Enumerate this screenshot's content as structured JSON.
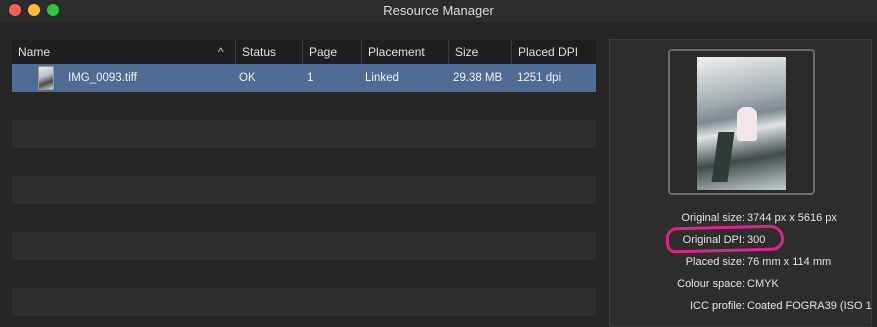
{
  "window": {
    "title": "Resource Manager"
  },
  "table": {
    "columns": [
      "Name",
      "Status",
      "Page",
      "Placement",
      "Size",
      "Placed DPI"
    ],
    "rows": [
      {
        "name": "IMG_0093.tiff",
        "status": "OK",
        "page": "1",
        "placement": "Linked",
        "size": "29.38 MB",
        "placed_dpi": "1251 dpi"
      }
    ]
  },
  "details": {
    "original_size_label": "Original size:",
    "original_size_value": "3744 px x 5616 px",
    "original_dpi_label": "Original DPI:",
    "original_dpi_value": "300",
    "placed_size_label": "Placed size:",
    "placed_size_value": "76 mm x 114 mm",
    "colour_space_label": "Colour space:",
    "colour_space_value": "CMYK",
    "icc_profile_label": "ICC profile:",
    "icc_profile_value": "Coated FOGRA39 (ISO 1"
  },
  "colors": {
    "selection": "#4f6d94",
    "highlight_annotation": "#e0218a"
  }
}
